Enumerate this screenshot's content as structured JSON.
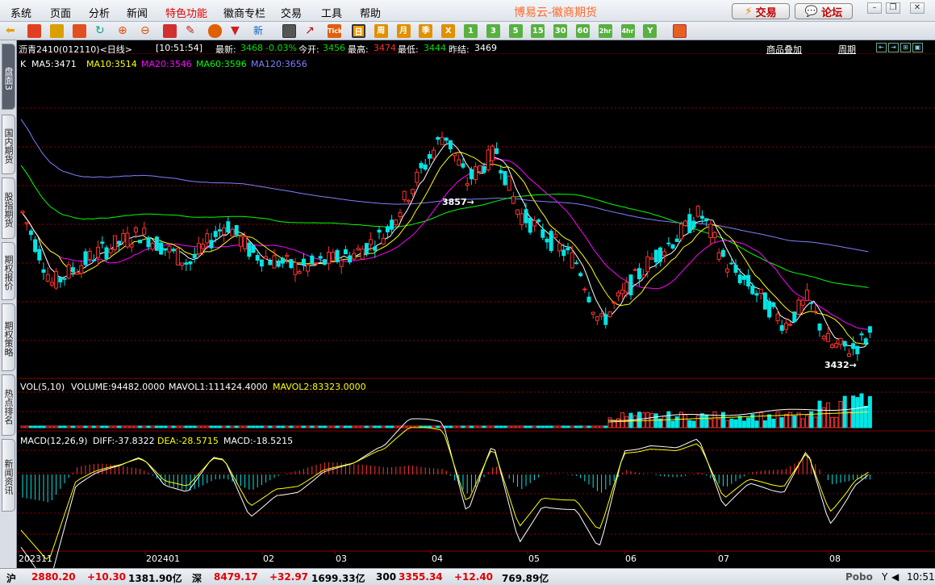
{
  "menu": {
    "items": [
      "系统",
      "页面",
      "分析",
      "新闻",
      "特色功能",
      "徽商专栏",
      "交易",
      "工具",
      "帮助"
    ],
    "highlight": 4,
    "brand": "博易云-徽商期货"
  },
  "topright": {
    "trade": "交易",
    "forum": "论坛"
  },
  "toolbar": {
    "period_buttons": [
      "日",
      "周",
      "月",
      "季",
      "X",
      "1",
      "3",
      "5",
      "15",
      "30",
      "60",
      "2hr",
      "4hr",
      "Y"
    ],
    "active_period": "日"
  },
  "sidebar": {
    "tabs": [
      "盘面3",
      "国内期货",
      "股指期货",
      "期权报价",
      "期权策略",
      "热点排名",
      "新闻资讯"
    ],
    "active": 0
  },
  "infobar": {
    "title": "沥青2410(012110)<日线>",
    "time": "[10:51:54]",
    "latest_label": "最新:",
    "latest": "3468",
    "change": "-0.03%",
    "open_label": "今开:",
    "open": "3456",
    "high_label": "最高:",
    "high": "3474",
    "low_label": "最低:",
    "low": "3444",
    "prev_label": "昨结:",
    "prev": "3469",
    "overlay_link": "商品叠加",
    "cycle_link": "周期"
  },
  "ma_legend": {
    "k": "K",
    "ma5": "MA5:3471",
    "ma10": "MA10:3514",
    "ma20": "MA20:3546",
    "ma60": "MA60:3596",
    "ma120": "MA120:3656"
  },
  "vol_legend": {
    "name": "VOL(5,10)",
    "volume": "VOLUME:94482.0000",
    "mavol1": "MAVOL1:111424.4000",
    "mavol2": "MAVOL2:83323.0000"
  },
  "macd_legend": {
    "name": "MACD(12,26,9)",
    "diff": "DIFF:-37.8322",
    "dea": "DEA:-28.5715",
    "macd": "MACD:-18.5215"
  },
  "annotations": {
    "high": "3857",
    "low": "3432"
  },
  "xaxis": {
    "labels": [
      "202311",
      "202401",
      "02",
      "03",
      "04",
      "05",
      "06",
      "07",
      "08"
    ]
  },
  "status": {
    "sh_label": "沪",
    "sh_value": "2880.20",
    "sh_change": "+10.30",
    "sh_amount": "1381.90亿",
    "sz_label": "深",
    "sz_value": "8479.17",
    "sz_change": "+32.97",
    "sz_amount": "1699.33亿",
    "i300_label": "300",
    "i300_value": "3355.34",
    "i300_change": "+12.40",
    "i300_amount": "769.89亿",
    "brand": "Pobo",
    "clock": "10:51"
  },
  "colors": {
    "up": "#ff3232",
    "down": "#00e5e5",
    "ma5": "#ffffff",
    "ma10": "#ffff00",
    "ma20": "#ff00ff",
    "ma60": "#00ff00",
    "ma120": "#7f7fff",
    "grid": "#8b0000"
  }
}
